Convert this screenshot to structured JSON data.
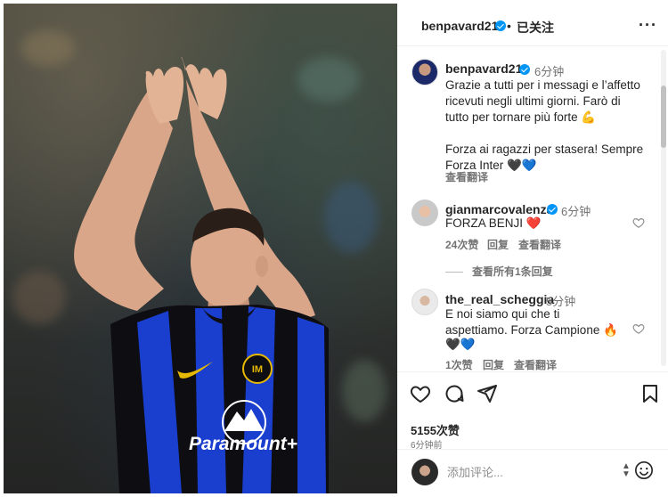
{
  "post": {
    "author": "benpavard21",
    "dot": "•",
    "follow_status": "已关注",
    "more_icon": "more-horizontal-icon",
    "caption": {
      "time": "6分钟",
      "line1": "Grazie a tutti per i messagi e l’affetto",
      "line2": "ricevuti negli ultimi giorni. Farò di",
      "line3": "tutto per tornare più forte 💪",
      "line4": "Forza ai ragazzi per stasera! Sempre",
      "line5": "Forza Inter 🖤💙",
      "translate": "查看翻译"
    },
    "likes": "5155次赞",
    "posted_ago": "6分钟前"
  },
  "comments": [
    {
      "user": "gianmarcovalenza",
      "verified": true,
      "time": "6分钟",
      "text": "FORZA BENJI ❤️",
      "likes": "24次赞",
      "reply": "回复",
      "translate": "查看翻译",
      "view_replies": "查看所有1条回复"
    },
    {
      "user": "the_real_scheggia",
      "verified": false,
      "time": "5分钟",
      "text1": "E noi siamo qui che ti",
      "text2": "aspettiamo. Forza Campione 🔥",
      "text3": "🖤💙",
      "likes": "1次赞",
      "reply": "回复",
      "translate": "查看翻译"
    }
  ],
  "compose": {
    "placeholder": "添加评论...",
    "emoji_icon": "smiley-icon"
  },
  "photo": {
    "jersey_sponsor": "Paramount+"
  },
  "colors": {
    "verified": "#0095f6",
    "muted": "#737373",
    "jersey_blue": "#1a3fcf",
    "jersey_black": "#0d0d12"
  }
}
